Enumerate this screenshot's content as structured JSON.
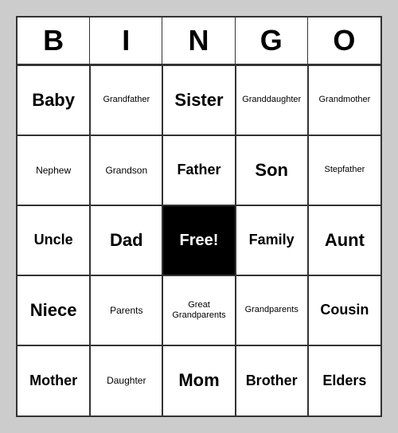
{
  "header": {
    "letters": [
      "B",
      "I",
      "N",
      "G",
      "O"
    ]
  },
  "grid": [
    [
      {
        "text": "Baby",
        "size": "large"
      },
      {
        "text": "Grandfather",
        "size": "xsmall"
      },
      {
        "text": "Sister",
        "size": "large"
      },
      {
        "text": "Granddaughter",
        "size": "xsmall"
      },
      {
        "text": "Grandmother",
        "size": "xsmall"
      }
    ],
    [
      {
        "text": "Nephew",
        "size": "small"
      },
      {
        "text": "Grandson",
        "size": "small"
      },
      {
        "text": "Father",
        "size": "medium"
      },
      {
        "text": "Son",
        "size": "large"
      },
      {
        "text": "Stepfather",
        "size": "xsmall"
      }
    ],
    [
      {
        "text": "Uncle",
        "size": "medium"
      },
      {
        "text": "Dad",
        "size": "large"
      },
      {
        "text": "Free!",
        "size": "free"
      },
      {
        "text": "Family",
        "size": "medium"
      },
      {
        "text": "Aunt",
        "size": "large"
      }
    ],
    [
      {
        "text": "Niece",
        "size": "large"
      },
      {
        "text": "Parents",
        "size": "small"
      },
      {
        "text": "Great Grandparents",
        "size": "xsmall"
      },
      {
        "text": "Grandparents",
        "size": "xsmall"
      },
      {
        "text": "Cousin",
        "size": "medium"
      }
    ],
    [
      {
        "text": "Mother",
        "size": "medium"
      },
      {
        "text": "Daughter",
        "size": "small"
      },
      {
        "text": "Mom",
        "size": "large"
      },
      {
        "text": "Brother",
        "size": "medium"
      },
      {
        "text": "Elders",
        "size": "medium"
      }
    ]
  ]
}
